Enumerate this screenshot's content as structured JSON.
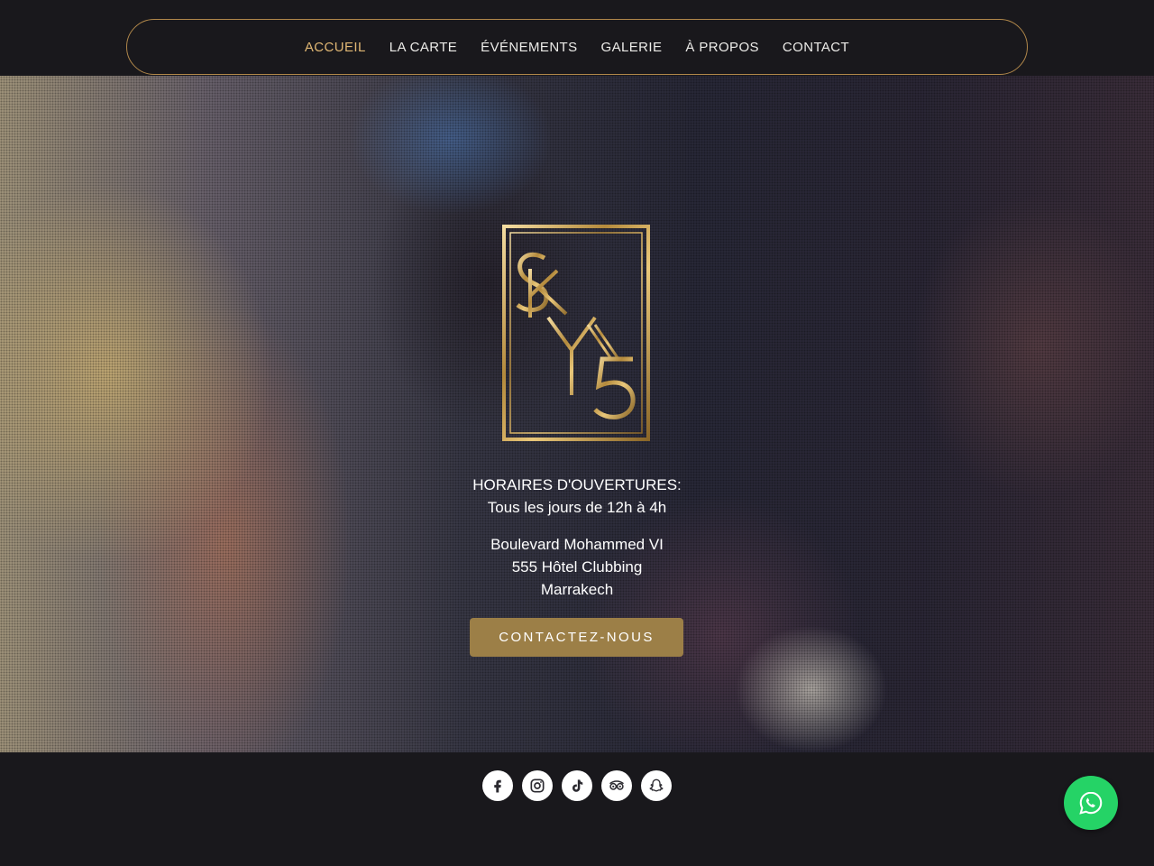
{
  "nav": {
    "items": [
      {
        "label": "ACCUEIL",
        "active": true
      },
      {
        "label": "LA CARTE",
        "active": false
      },
      {
        "label": "ÉVÉNEMENTS",
        "active": false
      },
      {
        "label": "GALERIE",
        "active": false
      },
      {
        "label": "À PROPOS",
        "active": false
      },
      {
        "label": "CONTACT",
        "active": false
      }
    ]
  },
  "hero": {
    "logo_text": "SKY5",
    "hours_title": "HORAIRES D'OUVERTURES:",
    "hours_text": "Tous les jours de 12h à 4h",
    "address": [
      "Boulevard Mohammed VI",
      "555 Hôtel Clubbing",
      "Marrakech"
    ],
    "cta_label": "CONTACTEZ-NOUS"
  },
  "footer": {
    "socials": [
      "facebook-icon",
      "instagram-icon",
      "tiktok-icon",
      "tripadvisor-icon",
      "snapchat-icon"
    ]
  },
  "whatsapp": {
    "icon": "whatsapp-icon"
  },
  "colors": {
    "accent": "#e0b774",
    "border": "#b0874a",
    "cta": "#9c7f47",
    "background": "#19181c",
    "whatsapp": "#25d366"
  }
}
